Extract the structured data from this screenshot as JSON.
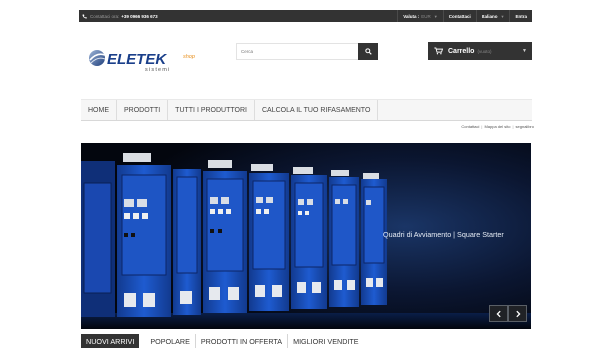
{
  "topbar": {
    "call_label": "Contattaci ora:",
    "phone": "+39 0966 936 673",
    "currency_label": "Valuta :",
    "currency_value": "EUR",
    "contact": "Contattaci",
    "language": "Italiano",
    "login": "Entra"
  },
  "logo": {
    "brand": "ELETEK",
    "tagline": "sistemi",
    "suffix": "shop"
  },
  "search": {
    "placeholder": "Cerca"
  },
  "cart": {
    "label": "Carrello",
    "status": "(vuoto)"
  },
  "nav": {
    "items": [
      "HOME",
      "PRODOTTI",
      "TUTTI I PRODUTTORI",
      "CALCOLA IL TUO RIFASAMENTO"
    ]
  },
  "quicklinks": [
    "Contattaci",
    "Mappa del sito",
    "segnalibro"
  ],
  "banner": {
    "caption": "Quadri di Avviamento | Square Starter"
  },
  "tabs": [
    "NUOVI ARRIVI",
    "POPOLARE",
    "PRODOTTI IN OFFERTA",
    "MIGLIORI VENDITE"
  ],
  "colors": {
    "dark": "#333333",
    "logo_blue": "#1a3f8a",
    "logo_orange": "#e8901e",
    "cabinet_blue": "#1b4db5"
  },
  "icons": {
    "phone": "phone-icon",
    "search": "search-icon",
    "cart": "cart-icon",
    "prev": "chevron-left-icon",
    "next": "chevron-right-icon"
  }
}
